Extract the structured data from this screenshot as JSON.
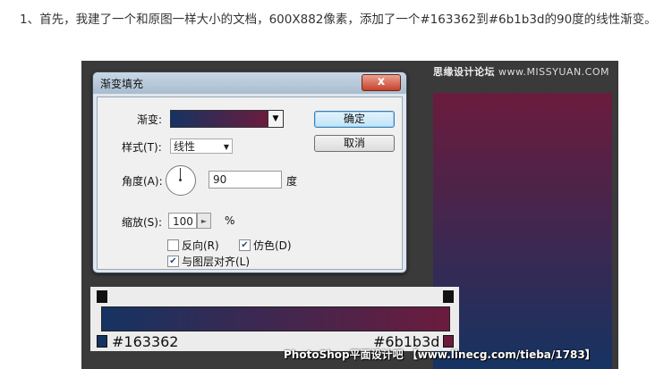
{
  "intro_text": "1、首先，我建了一个和原图一样大小的文档，600X882像素，添加了一个#163362到#6b1b3d的90度的线性渐变。",
  "watermark_top": {
    "brand": "思缘设计论坛",
    "url": "www.MISSYUAN.COM"
  },
  "dialog": {
    "title": "渐变填充",
    "close": "x",
    "gradient_label": "渐变:",
    "style_label": "样式(T):",
    "style_value": "线性",
    "angle_label": "角度(A):",
    "angle_value": "90",
    "angle_unit": "度",
    "scale_label": "缩放(S):",
    "scale_value": "100",
    "scale_unit": "%",
    "reverse_label": "反向(R)",
    "reverse_checked": false,
    "dither_label": "仿色(D)",
    "dither_checked": true,
    "align_label": "与图层对齐(L)",
    "align_checked": true,
    "ok_label": "确定",
    "cancel_label": "取消"
  },
  "gradient_editor": {
    "start_color": "#163362",
    "end_color": "#6b1b3d",
    "start_label": "#163362",
    "end_label": "#6b1b3d"
  },
  "watermark_bottom": "PhotoShop平面设计吧 【www.linecg.com/tieba/1783】",
  "colors": {
    "gradient_start": "#163362",
    "gradient_end": "#6b1b3d"
  }
}
